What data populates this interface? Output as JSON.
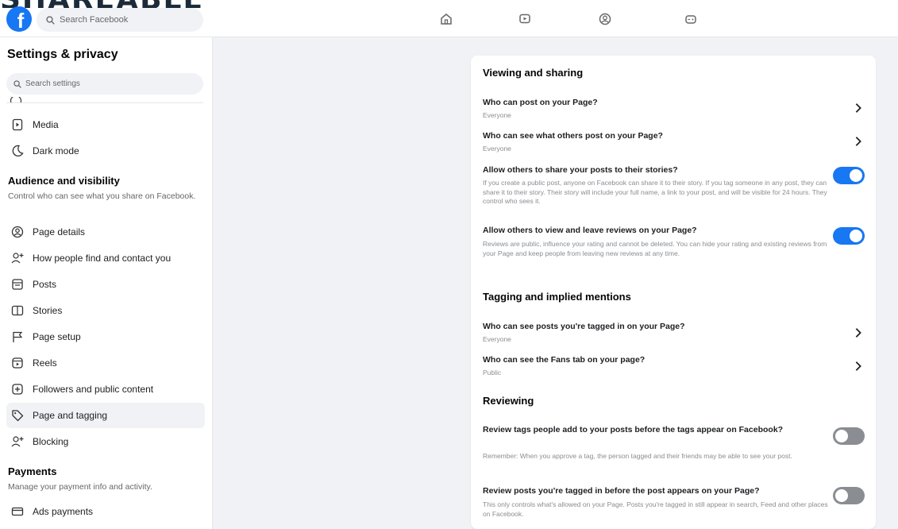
{
  "watermark": "SHAREABLE",
  "topbar": {
    "logo_letter": "f",
    "search_placeholder": "Search Facebook",
    "nav_icons": [
      "home-icon",
      "watch-icon",
      "profile-icon",
      "gaming-icon"
    ]
  },
  "sidebar": {
    "title": "Settings & privacy",
    "search_placeholder": "Search settings",
    "top_items": [
      {
        "label": "Media",
        "icon": "media-icon"
      },
      {
        "label": "Dark mode",
        "icon": "moon-icon"
      }
    ],
    "audience": {
      "heading": "Audience and visibility",
      "description": "Control who can see what you share on Facebook.",
      "items": [
        {
          "label": "Page details",
          "icon": "page-details-icon"
        },
        {
          "label": "How people find and contact you",
          "icon": "person-add-icon"
        },
        {
          "label": "Posts",
          "icon": "posts-icon"
        },
        {
          "label": "Stories",
          "icon": "stories-icon"
        },
        {
          "label": "Page setup",
          "icon": "flag-icon"
        },
        {
          "label": "Reels",
          "icon": "reels-icon"
        },
        {
          "label": "Followers and public content",
          "icon": "followers-icon"
        },
        {
          "label": "Page and tagging",
          "icon": "tag-icon",
          "active": true
        },
        {
          "label": "Blocking",
          "icon": "block-user-icon"
        }
      ]
    },
    "payments": {
      "heading": "Payments",
      "description": "Manage your payment info and activity.",
      "items": [
        {
          "label": "Ads payments",
          "icon": "credit-card-icon"
        }
      ]
    }
  },
  "main": {
    "viewing": {
      "heading": "Viewing and sharing",
      "rows": [
        {
          "title": "Who can post on your Page?",
          "value": "Everyone"
        },
        {
          "title": "Who can see what others post on your Page?",
          "value": "Everyone"
        }
      ],
      "toggles": [
        {
          "title": "Allow others to share your posts to their stories?",
          "description": "If you create a public post, anyone on Facebook can share it to their story. If you tag someone in any post, they can share it to their story. Their story will include your full name, a link to your post, and will be visible for 24 hours. They control who sees it.",
          "on": true
        },
        {
          "title": "Allow others to view and leave reviews on your Page?",
          "description": "Reviews are public, influence your rating and cannot be deleted. You can hide your rating and existing reviews from your Page and keep people from leaving new reviews at any time.",
          "on": true
        }
      ]
    },
    "tagging": {
      "heading": "Tagging and implied mentions",
      "rows": [
        {
          "title": "Who can see posts you're tagged in on your Page?",
          "value": "Everyone"
        },
        {
          "title": "Who can see the Fans tab on your page?",
          "value": "Public"
        }
      ]
    },
    "reviewing": {
      "heading": "Reviewing",
      "toggles": [
        {
          "title": "Review tags people add to your posts before the tags appear on Facebook?",
          "description": "Remember: When you approve a tag, the person tagged and their friends may be able to see your post.",
          "on": false
        },
        {
          "title": "Review posts you're tagged in before the post appears on your Page?",
          "description": "This only controls what's allowed on your Page. Posts you're tagged in still appear in search, Feed and other places on Facebook.",
          "on": false
        }
      ]
    }
  },
  "colors": {
    "brand": "#1877f2",
    "toggle_off": "#8a8d91",
    "background": "#f0f2f5"
  }
}
